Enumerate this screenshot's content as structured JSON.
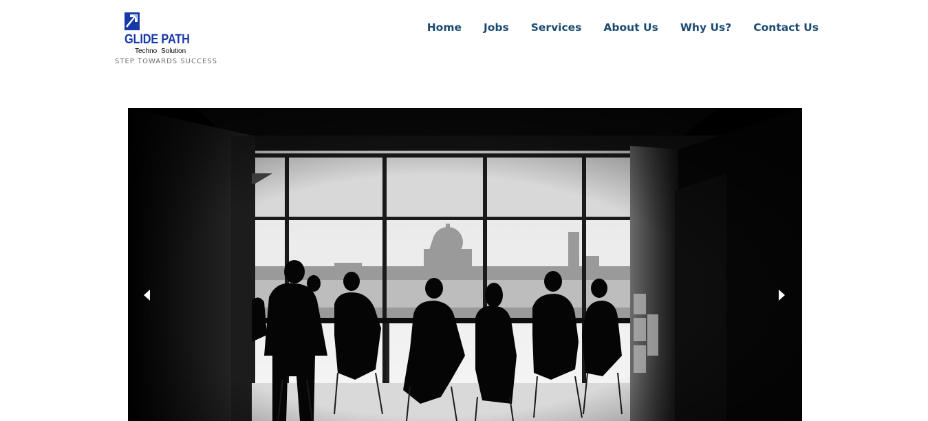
{
  "brand": {
    "name": "GLIDE PATH",
    "subtitle": "Techno Solution",
    "tagline": "STEP TOWARDS SUCCESS",
    "color": "#1638a8"
  },
  "nav": {
    "items": [
      {
        "label": "Home"
      },
      {
        "label": "Jobs"
      },
      {
        "label": "Services"
      },
      {
        "label": "About Us"
      },
      {
        "label": "Why Us?"
      },
      {
        "label": "Contact Us"
      }
    ],
    "color": "#1b4b72"
  },
  "slider": {
    "image": "office-meeting-silhouette-photo",
    "prev_icon": "triangle-left-icon",
    "next_icon": "triangle-right-icon"
  }
}
